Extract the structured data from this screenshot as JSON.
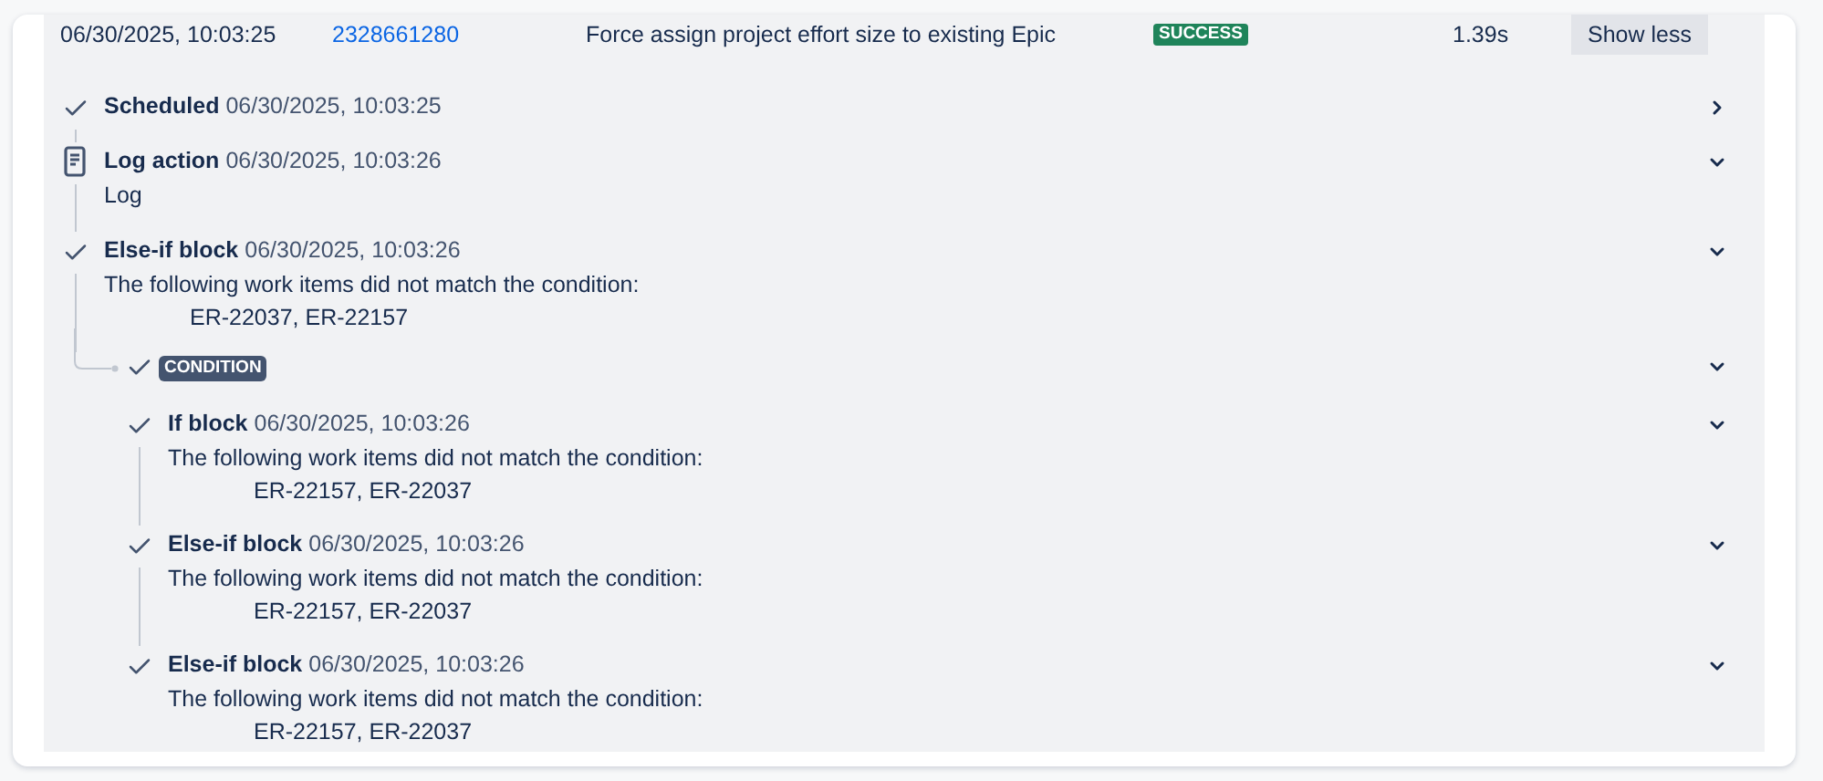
{
  "run": {
    "date": "06/30/2025, 10:03:25",
    "id": "2328661280",
    "rule": "Force assign project effort size to existing Epic",
    "status": "SUCCESS",
    "duration": "1.39s",
    "toggle_button": "Show less"
  },
  "steps": [
    {
      "kind": "check",
      "title": "Scheduled",
      "time": "06/30/2025, 10:03:25",
      "expanded": false
    },
    {
      "kind": "log",
      "title": "Log action",
      "time": "06/30/2025, 10:03:26",
      "expanded": true,
      "message": "Log"
    },
    {
      "kind": "check",
      "title": "Else-if block",
      "time": "06/30/2025, 10:03:26",
      "expanded": true,
      "message": "The following work items did not match the condition:",
      "items": "ER-22037, ER-22157"
    },
    {
      "kind": "condition",
      "label": "CONDITION",
      "expanded": true,
      "children": [
        {
          "kind": "check",
          "title": "If block",
          "time": "06/30/2025, 10:03:26",
          "expanded": true,
          "message": "The following work items did not match the condition:",
          "items": "ER-22157, ER-22037"
        },
        {
          "kind": "check",
          "title": "Else-if block",
          "time": "06/30/2025, 10:03:26",
          "expanded": true,
          "message": "The following work items did not match the condition:",
          "items": "ER-22157, ER-22037"
        },
        {
          "kind": "check",
          "title": "Else-if block",
          "time": "06/30/2025, 10:03:26",
          "expanded": true,
          "message": "The following work items did not match the condition:",
          "items": "ER-22157, ER-22037"
        }
      ]
    }
  ]
}
